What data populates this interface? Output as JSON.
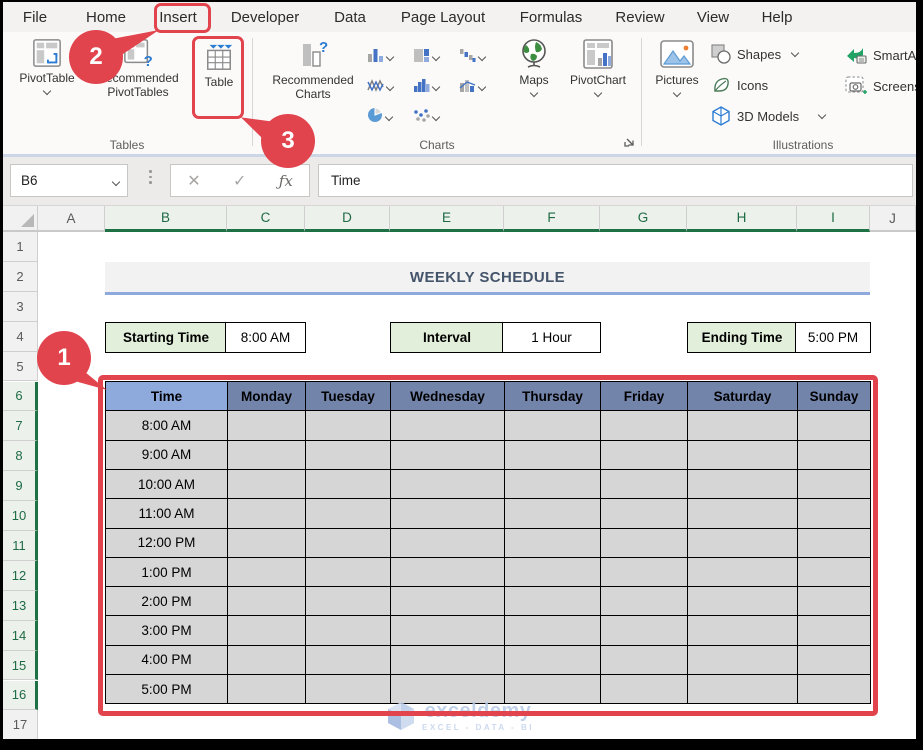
{
  "menubar": {
    "items": [
      {
        "label": "File"
      },
      {
        "label": "Home"
      },
      {
        "label": "Insert",
        "highlighted": true
      },
      {
        "label": "Developer"
      },
      {
        "label": "Data"
      },
      {
        "label": "Page Layout"
      },
      {
        "label": "Formulas"
      },
      {
        "label": "Review"
      },
      {
        "label": "View"
      },
      {
        "label": "Help"
      }
    ]
  },
  "ribbon": {
    "tables_group": {
      "label": "Tables",
      "pivottable": "PivotTable",
      "recommended_pivottables_line1": "Recommended",
      "recommended_pivottables_line2": "PivotTables",
      "table": "Table"
    },
    "charts_group": {
      "label": "Charts",
      "recommended_charts_line1": "Recommended",
      "recommended_charts_line2": "Charts",
      "maps": "Maps",
      "pivotchart": "PivotChart",
      "mini_icons": [
        "column-chart-icon",
        "treemap-chart-icon",
        "waterfall-chart-icon",
        "line-chart-icon",
        "histogram-chart-icon",
        "combo-chart-icon",
        "pie-chart-icon",
        "scatter-chart-icon"
      ]
    },
    "illustrations_group": {
      "label": "Illustrations",
      "pictures": "Pictures",
      "shapes": "Shapes",
      "icons": "Icons",
      "models_3d": "3D Models",
      "smartart": "SmartArt",
      "screenshot": "Screenshot"
    }
  },
  "formula_bar": {
    "name_box": "B6",
    "formula": "Time"
  },
  "grid": {
    "columns": [
      "A",
      "B",
      "C",
      "D",
      "E",
      "F",
      "G",
      "H",
      "I",
      "J"
    ],
    "selected_columns": [
      "B",
      "C",
      "D",
      "E",
      "F",
      "G",
      "H",
      "I"
    ],
    "rows": [
      "1",
      "2",
      "3",
      "4",
      "5",
      "6",
      "7",
      "8",
      "9",
      "10",
      "11",
      "12",
      "13",
      "14",
      "15",
      "16",
      "17"
    ],
    "selected_rows": [
      "6",
      "7",
      "8",
      "9",
      "10",
      "11",
      "12",
      "13",
      "14",
      "15",
      "16"
    ]
  },
  "sheet": {
    "title": "WEEKLY SCHEDULE",
    "params": [
      {
        "label": "Starting Time",
        "value": "8:00 AM"
      },
      {
        "label": "Interval",
        "value": "1 Hour"
      },
      {
        "label": "Ending Time",
        "value": "5:00 PM"
      }
    ]
  },
  "schedule": {
    "headers": [
      "Time",
      "Monday",
      "Tuesday",
      "Wednesday",
      "Thursday",
      "Friday",
      "Saturday",
      "Sunday"
    ],
    "times": [
      "8:00 AM",
      "9:00 AM",
      "10:00 AM",
      "11:00 AM",
      "12:00 PM",
      "1:00 PM",
      "2:00 PM",
      "3:00 PM",
      "4:00 PM",
      "5:00 PM"
    ]
  },
  "annotations": {
    "callouts": [
      "1",
      "2",
      "3"
    ]
  },
  "watermark": {
    "name": "exceldemy",
    "tagline": "EXCEL - DATA - BI"
  },
  "colors": {
    "annotation_red": "#E2444E",
    "excel_green": "#1E7145",
    "time_header_blue": "#8EA9DB",
    "day_header_blue": "#7384AB",
    "cell_gray": "#D6D6D6",
    "param_green": "#E2EFDA",
    "title_text": "#44546A",
    "title_underline": "#8EA9DB"
  }
}
